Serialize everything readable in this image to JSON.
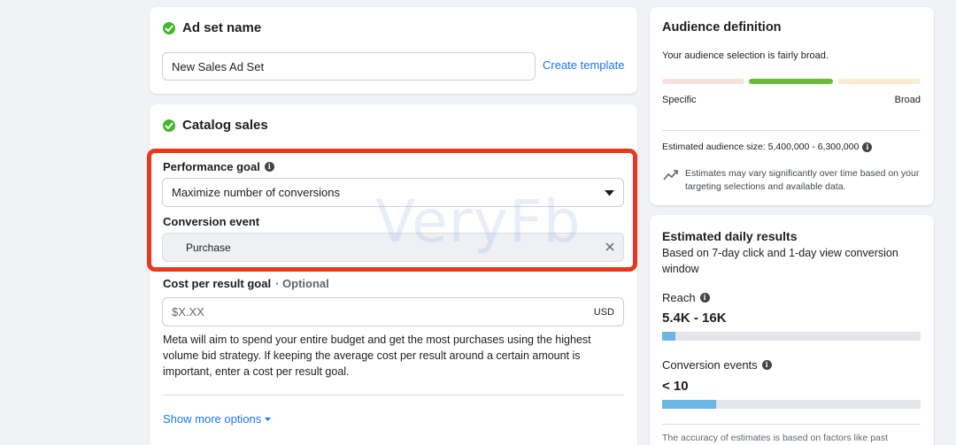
{
  "adset": {
    "title": "Ad set name",
    "name_value": "New Sales Ad Set",
    "create_template": "Create template"
  },
  "catalog": {
    "title": "Catalog sales",
    "performance_goal_label": "Performance goal",
    "performance_goal_value": "Maximize number of conversions",
    "conversion_event_label": "Conversion event",
    "conversion_event_value": "Purchase",
    "cost_label": "Cost per result goal",
    "cost_optional": "· Optional",
    "cost_placeholder": "$X.XX",
    "cost_currency": "USD",
    "description": "Meta will aim to spend your entire budget and get the most purchases using the highest volume bid strategy. If keeping the average cost per result around a certain amount is important, enter a cost per result goal.",
    "show_more": "Show more options"
  },
  "audience": {
    "title": "Audience definition",
    "selection_text": "Your audience selection is fairly broad.",
    "specific_label": "Specific",
    "broad_label": "Broad",
    "size_text": "Estimated audience size: 5,400,000 - 6,300,000",
    "estimates_note": "Estimates may vary significantly over time based on your targeting selections and available data."
  },
  "daily": {
    "title": "Estimated daily results",
    "subtitle": "Based on 7-day click and 1-day view conversion window",
    "reach_label": "Reach",
    "reach_value": "5.4K - 16K",
    "reach_fill": 0.05,
    "conversions_label": "Conversion events",
    "conversions_value": "< 10",
    "conversions_fill": 0.21,
    "accuracy_note": "The accuracy of estimates is based on factors like past"
  },
  "watermark": "VeryFb",
  "colors": {
    "highlight_border": "#e8391e",
    "accent": "#1877f2",
    "check_green": "#42b72a",
    "meter_active": "#6bba3a"
  }
}
